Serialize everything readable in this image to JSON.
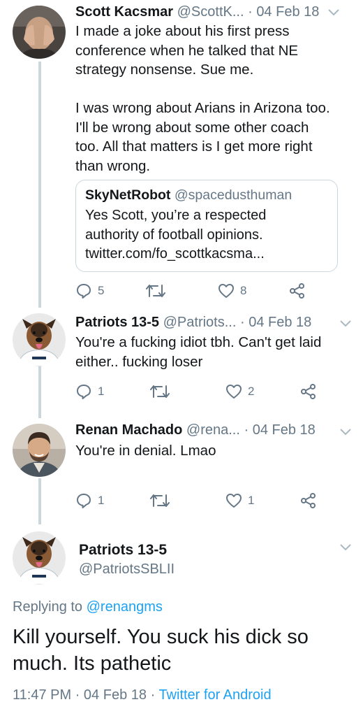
{
  "thread": [
    {
      "name": "Scott Kacsmar",
      "handle": "@ScottK...",
      "dot": "·",
      "date": "04 Feb 18",
      "text": "I made a joke about his first press\nconference when he talked that NE\nstrategy nonsense. Sue me.\n\nI was wrong about Arians in Arizona too.\nI'll be wrong about some other coach\ntoo. All that matters is I get more right\nthan wrong.",
      "quote": {
        "name": "SkyNetRobot",
        "handle": "@spacedusthuman",
        "text": "Yes Scott, you’re a respected\nauthority of football opinions.\ntwitter.com/fo_scottkacsma..."
      },
      "replies": "5",
      "retweets": "",
      "likes": "8"
    },
    {
      "name": "Patriots 13-5",
      "handle": "@Patriots...",
      "dot": "·",
      "date": "04 Feb 18",
      "text": "You're a fucking idiot tbh. Can't get laid\neither.. fucking loser",
      "replies": "1",
      "retweets": "",
      "likes": "2"
    },
    {
      "name": "Renan Machado",
      "handle": "@rena...",
      "dot": "·",
      "date": "04 Feb 18",
      "text": "You're in denial. Lmao",
      "replies": "1",
      "retweets": "",
      "likes": "1"
    }
  ],
  "main_tweet": {
    "name": "Patriots 13-5",
    "handle": "@PatriotsSBLII",
    "replying_prefix": "Replying to",
    "replying_to": "@renangms",
    "text": "Kill yourself. You suck his dick so much. Its pathetic",
    "time": "11:47 PM",
    "date": "04 Feb 18",
    "source": "Twitter for Android",
    "separator": "·"
  },
  "icons": {
    "reply": "reply-icon",
    "retweet": "retweet-icon",
    "like": "heart-icon",
    "share": "share-icon",
    "caret": "chevron-down-icon"
  },
  "colors": {
    "text": "#14171a",
    "secondary": "#657786",
    "link": "#1da1f2",
    "border": "#ccd6dd"
  }
}
